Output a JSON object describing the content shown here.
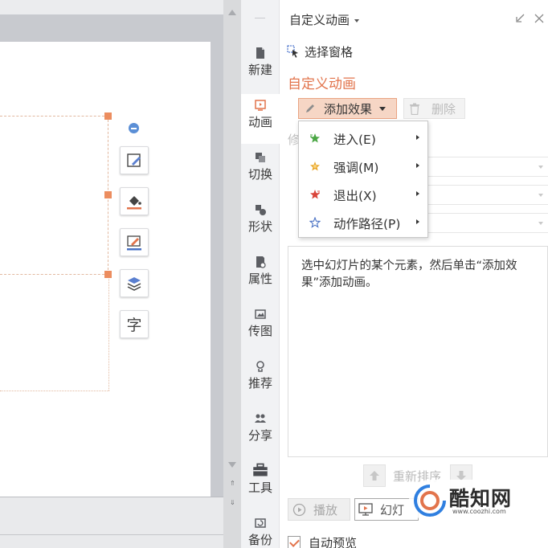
{
  "colors": {
    "accent": "#e2744c",
    "handle": "#ec8d5f",
    "selection_border": "#e2b9a0"
  },
  "float_tools": [
    {
      "name": "edit-shape-icon"
    },
    {
      "name": "fill-bucket-icon"
    },
    {
      "name": "outline-pen-icon"
    },
    {
      "name": "layers-icon"
    },
    {
      "name": "text-icon",
      "glyph": "字"
    }
  ],
  "sidebar": {
    "items": [
      {
        "label": "新建",
        "icon": "file-new-icon"
      },
      {
        "label": "动画",
        "icon": "animation-icon",
        "active": true
      },
      {
        "label": "切换",
        "icon": "transition-icon"
      },
      {
        "label": "形状",
        "icon": "shapes-icon"
      },
      {
        "label": "属性",
        "icon": "properties-icon"
      },
      {
        "label": "传图",
        "icon": "upload-image-icon"
      },
      {
        "label": "推荐",
        "icon": "recommend-icon"
      },
      {
        "label": "分享",
        "icon": "share-icon"
      },
      {
        "label": "工具",
        "icon": "toolbox-icon"
      },
      {
        "label": "备份",
        "icon": "backup-icon"
      }
    ]
  },
  "panel": {
    "title": "自定义动画",
    "selection_pane": "选择窗格",
    "section_heading": "自定义动画",
    "add_effect": "添加效果",
    "delete": "删除",
    "modify_label": "修",
    "list_hint": "选中幻灯片的某个元素，然后单击“添加效果”添加动画。",
    "reorder": "重新排序",
    "play": "播放",
    "slideshow": "幻灯",
    "auto_preview": "自动预览"
  },
  "effect_menu": {
    "items": [
      {
        "label": "进入(E)",
        "icon": "enter-star-icon",
        "color": "#4aa644"
      },
      {
        "label": "强调(M)",
        "icon": "emphasis-star-icon",
        "color": "#e9a62b"
      },
      {
        "label": "退出(X)",
        "icon": "exit-star-icon",
        "color": "#d9443a"
      },
      {
        "label": "动作路径(P)",
        "icon": "motion-path-star-icon",
        "color": "#4a72c4"
      }
    ]
  },
  "watermark": {
    "name": "酷知网",
    "url": "www.coozhi.com"
  }
}
